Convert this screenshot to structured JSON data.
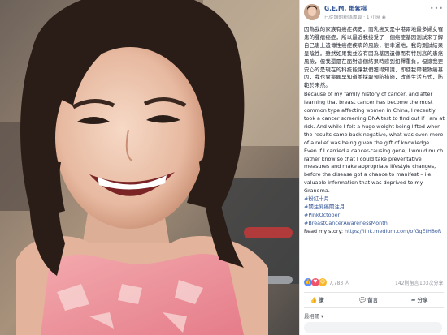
{
  "post": {
    "author": "G.E.M. 鄧紫棋",
    "time": "1 小時",
    "audience": "已從讚的粉絲專頁",
    "chinese_text": "因為我的家族有癌症病史，而乳癌又是中港兩地最多婦女罹患的腫瘤癌症，所以最近我接受了一個癌症基因測試來了解自己患上遺傳性癌症疾病的風險，很幸運地，我的測試結果呈陰性。雖然如果我並沒有因為基因遺傳而有特別高的患癌風險，但我還是在面對這個結果時感到如釋重負，但讓我更安心的是現在的科技能讓我們獲得知識，即使我帶著致癌基因，我也會寧願早知道並採取預防措施，改善生活方式，防範於未然。",
    "english_text": "Because of my family history of cancer, and after learning that breast cancer has become the most common type affecting women in China, I recently took a cancer screening DNA test to find out if I am at risk. And while I felt a huge weight being lifted when the results came back negative, what was even more of a relief was being given the gift of knowledge. Even if I carried a cancer-causing gene, I would much rather know so that I could take preventative measures and make appropriate lifestyle changes, before the disease got a chance to manifest – i.e. valuable information that was deprived to my Grandma.",
    "hashtags": [
      "#粉紅十月",
      "#關注乳癌關注月",
      "#PinkOctober",
      "#BreastCancerAwarenessMonth"
    ],
    "read_story_label": "Read my story: ",
    "link": "https://link.medium.com/ofGgEtH8oR"
  },
  "reactions": {
    "count": "7,783 人",
    "comments": "142則留言",
    "shares": "103次分享"
  },
  "actions": {
    "like": "讚",
    "comment": "留言",
    "share": "分享"
  },
  "comments": {
    "sort_label": "最相關 ▾"
  },
  "icons": {
    "more": "more-icon",
    "globe": "globe-icon",
    "like": "thumbs-up-icon",
    "comment": "comment-icon",
    "share": "share-icon"
  },
  "colors": {
    "link": "#365899",
    "text": "#1d2129",
    "meta": "#90949c"
  }
}
